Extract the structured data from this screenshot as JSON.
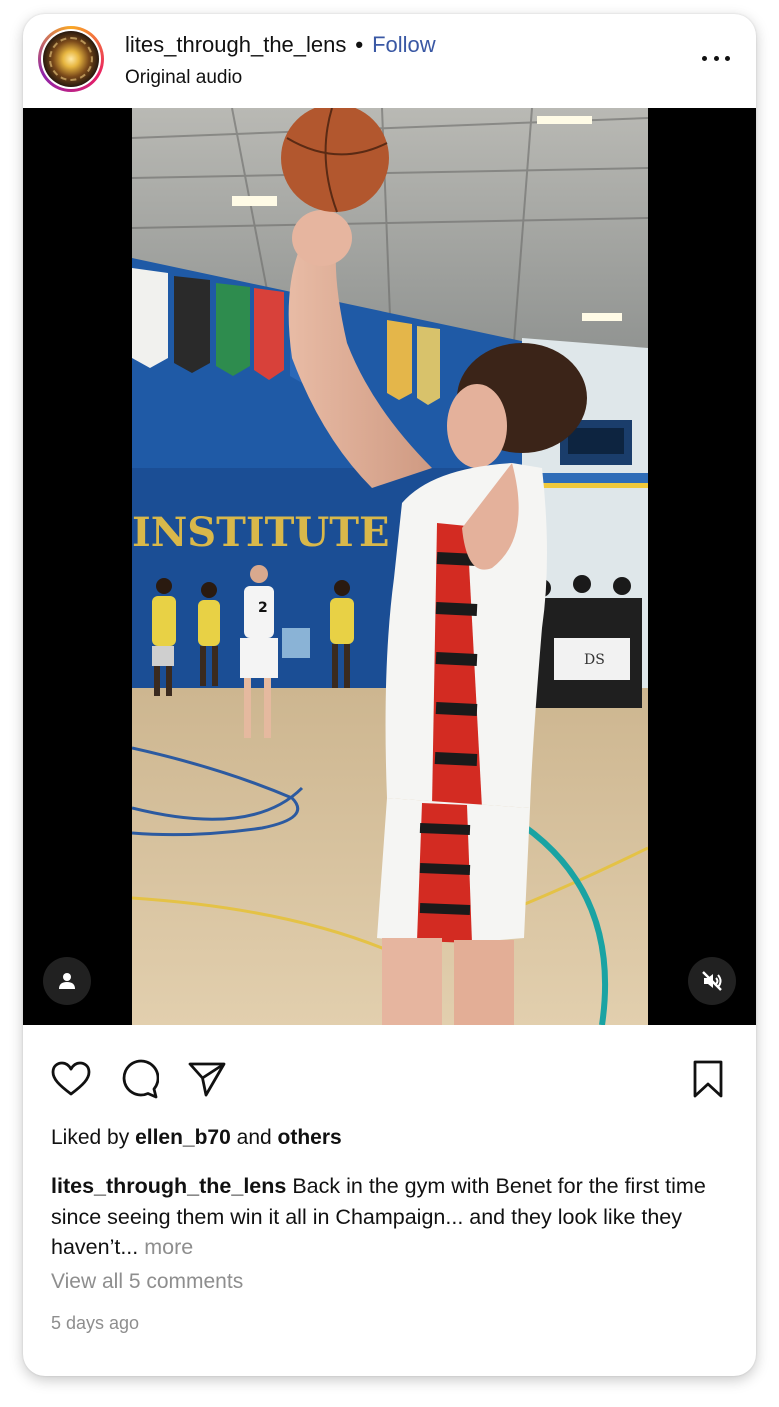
{
  "post": {
    "username": "lites_through_the_lens",
    "separator": "•",
    "follow_label": "Follow",
    "audio": "Original audio",
    "more_icon": "more-horizontal-icon"
  },
  "media": {
    "user_tag_icon": "person-icon",
    "mute_icon": "speaker-muted-icon",
    "scene_text": {
      "banner_text": "INSTITUTE",
      "jersey_number": "2",
      "table_logo": "DS"
    }
  },
  "actions": {
    "like_icon": "heart-icon",
    "comment_icon": "comment-icon",
    "share_icon": "paper-plane-icon",
    "save_icon": "bookmark-icon"
  },
  "likes": {
    "prefix": "Liked by",
    "user": "ellen_b70",
    "conjunction": "and",
    "others": "others"
  },
  "caption": {
    "username": "lites_through_the_lens",
    "text": "Back in the gym with Benet for the first time since seeing them win it all in Champaign... and they look like they haven’t...",
    "more_label": "more"
  },
  "comments": {
    "view_all_label": "View all 5 comments"
  },
  "timestamp": "5 days ago",
  "colors": {
    "follow": "#3a58a4",
    "muted_text": "#8e8e8e",
    "court_wall": "#1f5aa6",
    "court_floor": "#d9c19a"
  }
}
